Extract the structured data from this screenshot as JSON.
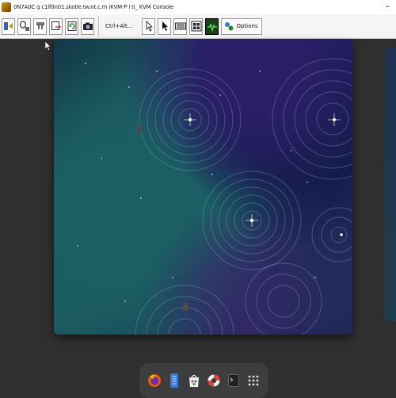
{
  "window": {
    "title": "0N7A0C q c1lf0n01.skotle.tw.nt.c.m iKVM-P i ti_ KVM Console",
    "minimize_glyph": "–"
  },
  "toolbar": {
    "buttons": [
      {
        "name": "virtual-media-icon"
      },
      {
        "name": "mouse-mode-icon"
      },
      {
        "name": "usb-icon"
      },
      {
        "name": "record-icon"
      },
      {
        "name": "refresh-icon"
      },
      {
        "name": "screenshot-camera-icon"
      }
    ],
    "ctrl_alt_label": "Ctrl+Alt...",
    "right_buttons": [
      {
        "name": "single-cursor-icon"
      },
      {
        "name": "pointer-icon"
      },
      {
        "name": "keyboard-icon"
      },
      {
        "name": "fullscreen-icon"
      },
      {
        "name": "monitor-graph-icon",
        "active": true
      }
    ],
    "options_label": "Options"
  },
  "dock": {
    "apps": [
      {
        "name": "firefox-icon"
      },
      {
        "name": "text-editor-icon"
      },
      {
        "name": "software-center-icon"
      },
      {
        "name": "help-lifebuoy-icon"
      },
      {
        "name": "terminal-icon"
      },
      {
        "name": "app-grid-icon"
      }
    ]
  },
  "colors": {
    "desktop_bg": "#2f2f2f",
    "toolbar_bg": "#f5f5f5",
    "dock_bg": "#3d3d3d",
    "active_button": "#1b3d1b"
  }
}
